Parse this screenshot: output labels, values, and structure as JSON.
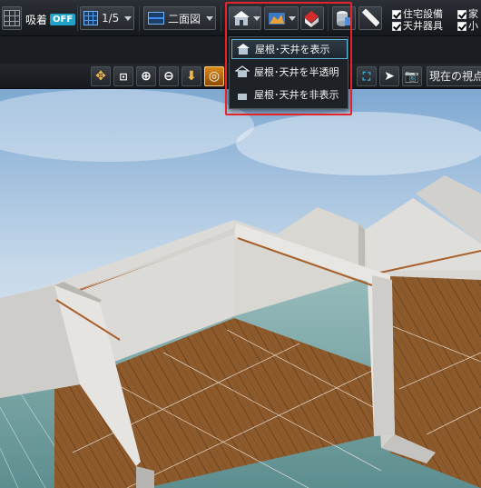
{
  "toolbar": {
    "snap_label": "吸着",
    "snap_state": "OFF",
    "scale_value": "1/5",
    "view_mode_label": "二面図",
    "roof_tooltip_caret": "",
    "checkboxes": [
      {
        "label": "住宅設備",
        "checked": true
      },
      {
        "label": "家",
        "checked": true
      },
      {
        "label": "天井器具",
        "checked": true
      },
      {
        "label": "小",
        "checked": true
      }
    ]
  },
  "roof_menu": {
    "items": [
      {
        "label": "屋根･天井を表示",
        "selected": true
      },
      {
        "label": "屋根･天井を半透明",
        "selected": false
      },
      {
        "label": "屋根･天井を非表示",
        "selected": false
      }
    ]
  },
  "view_toolbar": {
    "current_view_label": "現在の視点"
  },
  "colors": {
    "accent": "#1fa3c8",
    "highlight_border": "#e4232b",
    "floor": "#8b5a2b",
    "wall": "#dcdad6",
    "sky": "#8fb5d8"
  }
}
